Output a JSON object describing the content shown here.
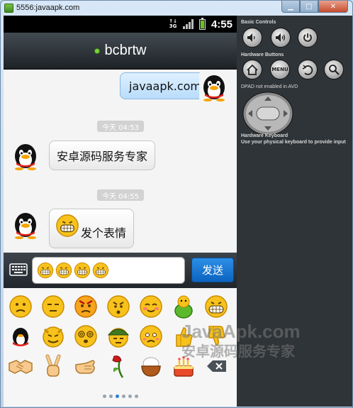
{
  "window": {
    "title": "5556:javaapk.com"
  },
  "status_bar": {
    "network": "3G",
    "time": "4:55"
  },
  "chat": {
    "contact_name": "bcbrtw",
    "messages": [
      {
        "type": "outgoing",
        "text": "javaapk.com"
      },
      {
        "type": "timestamp",
        "text": "今天 04:53"
      },
      {
        "type": "incoming",
        "text": "安卓源码服务专家"
      },
      {
        "type": "timestamp",
        "text": "今天 04:55"
      },
      {
        "type": "incoming",
        "text": "发个表情"
      }
    ]
  },
  "input": {
    "send_label": "发送"
  },
  "emoji_panel": {
    "pages": 6,
    "active_page": 3
  },
  "watermark": {
    "line1": "JavaApk.com",
    "line2": "安卓源码服务专家"
  },
  "emulator": {
    "basic_controls": "Basic Controls",
    "hardware_buttons": "Hardware Buttons",
    "menu_label": "MENU",
    "dpad_note": "DPAD not enabled in AVD",
    "keyboard_title": "Hardware Keyboard",
    "keyboard_note": "Use your physical keyboard to provide input"
  },
  "colors": {
    "accent_blue": "#1a76d2",
    "titlebar": "#2b3137",
    "online": "#7bd33c"
  }
}
